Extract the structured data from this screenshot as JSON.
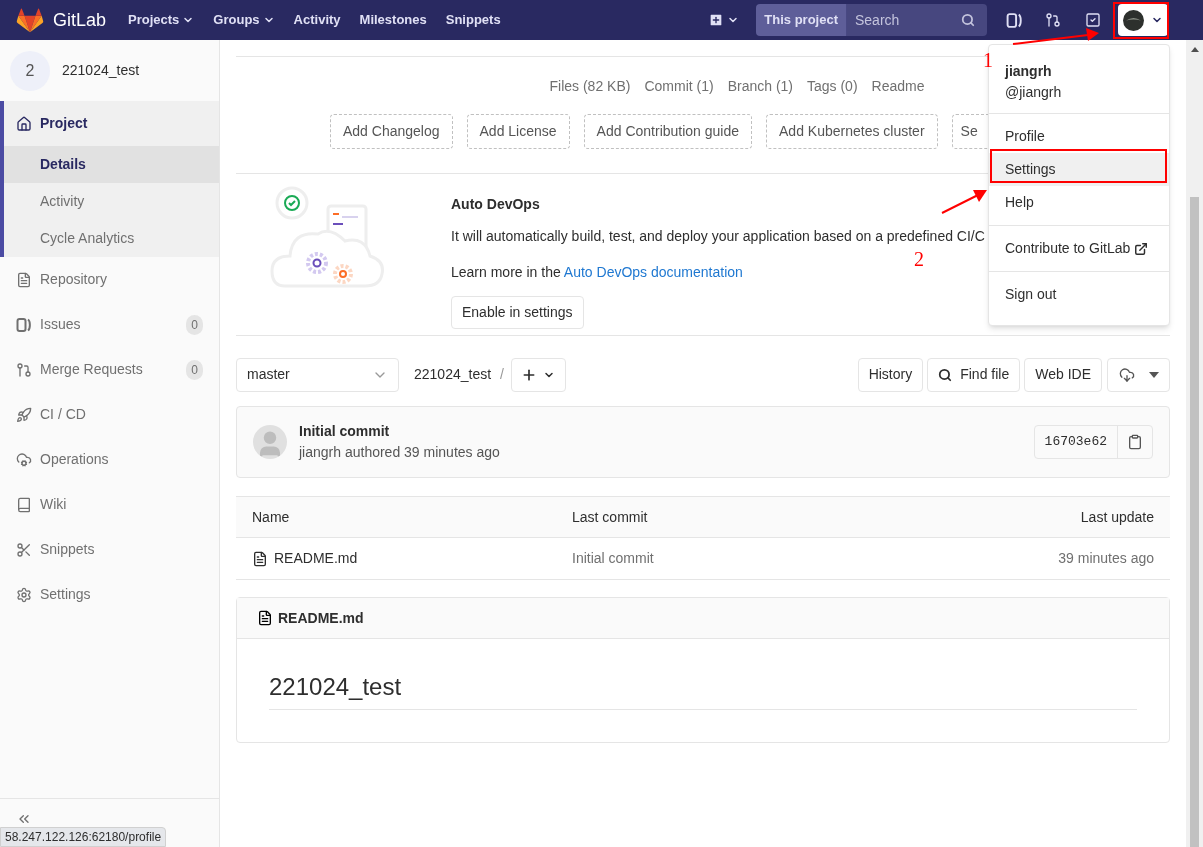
{
  "navbar": {
    "brand": "GitLab",
    "links": [
      {
        "label": "Projects",
        "dropdown": true
      },
      {
        "label": "Groups",
        "dropdown": true
      },
      {
        "label": "Activity",
        "dropdown": false
      },
      {
        "label": "Milestones",
        "dropdown": false
      },
      {
        "label": "Snippets",
        "dropdown": false
      }
    ],
    "search": {
      "scope": "This project",
      "placeholder": "Search"
    },
    "user_menu_open": true
  },
  "sidebar": {
    "project": {
      "avatar_letter": "2",
      "name": "221024_test"
    },
    "items": [
      {
        "label": "Project",
        "selected": true,
        "children": [
          {
            "label": "Details",
            "selected": true
          },
          {
            "label": "Activity",
            "selected": false
          },
          {
            "label": "Cycle Analytics",
            "selected": false
          }
        ]
      },
      {
        "label": "Repository",
        "selected": false
      },
      {
        "label": "Issues",
        "selected": false,
        "count": "0"
      },
      {
        "label": "Merge Requests",
        "selected": false,
        "count": "0"
      },
      {
        "label": "CI / CD",
        "selected": false
      },
      {
        "label": "Operations",
        "selected": false
      },
      {
        "label": "Wiki",
        "selected": false
      },
      {
        "label": "Snippets",
        "selected": false
      },
      {
        "label": "Settings",
        "selected": false
      }
    ]
  },
  "project_stats": [
    "Files (82 KB)",
    "Commit (1)",
    "Branch (1)",
    "Tags (0)",
    "Readme"
  ],
  "quick_actions": [
    "Add Changelog",
    "Add License",
    "Add Contribution guide",
    "Add Kubernetes cluster",
    "Se"
  ],
  "auto_devops": {
    "title": "Auto DevOps",
    "text": "It will automatically build, test, and deploy your application based on a predefined CI/C",
    "learn_more": "Learn more in the ",
    "link": "Auto DevOps documentation",
    "button": "Enable in settings"
  },
  "tree_controls": {
    "branch": "master",
    "path": "221024_test",
    "separator": "/",
    "buttons": [
      "History",
      "Find file",
      "Web IDE"
    ]
  },
  "last_commit": {
    "title": "Initial commit",
    "meta": "jiangrh authored 39 minutes ago",
    "sha": "16703e62"
  },
  "table": {
    "columns": [
      "Name",
      "Last commit",
      "Last update"
    ],
    "rows": [
      {
        "cells": [
          "README.md",
          "Initial commit",
          "39 minutes ago"
        ]
      }
    ]
  },
  "readme": {
    "file": "README.md",
    "heading": "221024_test"
  },
  "user_menu": {
    "name": "jiangrh",
    "handle": "@jiangrh",
    "groups": [
      [
        {
          "label": "Profile",
          "selected": false,
          "external": false
        },
        {
          "label": "Settings",
          "selected": true,
          "external": false
        },
        {
          "label": "Help",
          "selected": false,
          "external": false
        }
      ],
      [
        {
          "label": "Contribute to GitLab",
          "selected": false,
          "external": true
        }
      ],
      [
        {
          "label": "Sign out",
          "selected": false,
          "external": false
        }
      ]
    ]
  },
  "annotations": [
    {
      "label": "1"
    },
    {
      "label": "2"
    }
  ],
  "status_url": "58.247.122.126:62180/profile"
}
